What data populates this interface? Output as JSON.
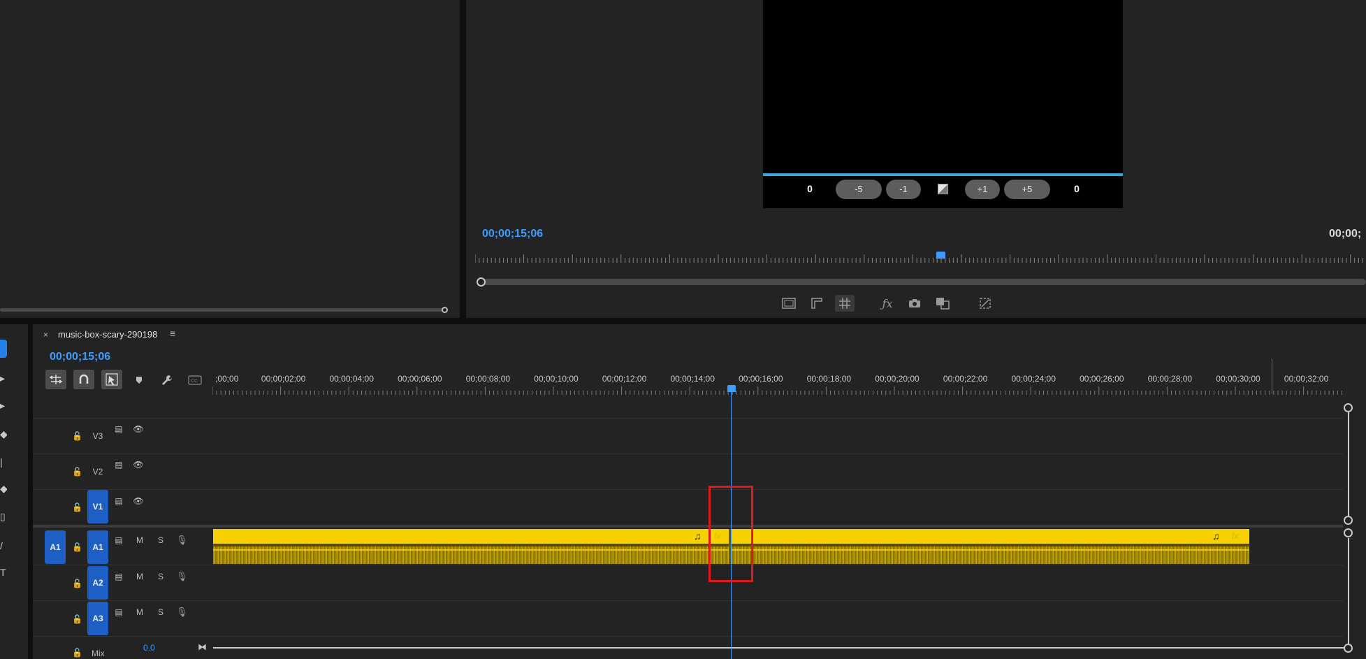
{
  "program_monitor": {
    "trim": {
      "left_value": "0",
      "minus5": "-5",
      "minus1": "-1",
      "plus1": "+1",
      "plus5": "+5",
      "right_value": "0"
    },
    "timecode": "00;00;15;06",
    "timecode_right": "00;00;"
  },
  "timeline": {
    "sequence_name": "music-box-scary-290198",
    "close_glyph": "×",
    "menu_glyph": "≡",
    "timecode": "00;00;15;06",
    "ruler_labels": [
      "00;00",
      "00;00;02;00",
      "00;00;04;00",
      "00;00;06;00",
      "00;00;08;00",
      "00;00;10;00",
      "00;00;12;00",
      "00;00;14;00",
      "00;00;16;00",
      "00;00;18;00",
      "00;00;20;00",
      "00;00;22;00",
      "00;00;24;00",
      "00;00;26;00",
      "00;00;28;00",
      "00;00;30;00",
      "00;00;32;00"
    ],
    "ruler_first_label": ";00;00",
    "tracks": {
      "v3": "V3",
      "v2": "V2",
      "v1": "V1",
      "a1_source": "A1",
      "a1": "A1",
      "a2": "A2",
      "a3": "A3",
      "mute": "M",
      "solo": "S"
    },
    "clip_fx": "fx",
    "clip_note": "♫",
    "mix": {
      "label": "Mix",
      "value": "0.0"
    }
  },
  "icons": {
    "ripple": "ripple-edit-icon",
    "snap": "snap-magnet-icon",
    "linked": "linked-selection-icon",
    "marker": "marker-icon",
    "wrench": "wrench-icon",
    "captions": "captions-icon"
  },
  "colors": {
    "accent": "#3d9dff",
    "clip": "#f7d200",
    "highlight": "#e01a1a",
    "track_select": "#1e5fc5"
  }
}
